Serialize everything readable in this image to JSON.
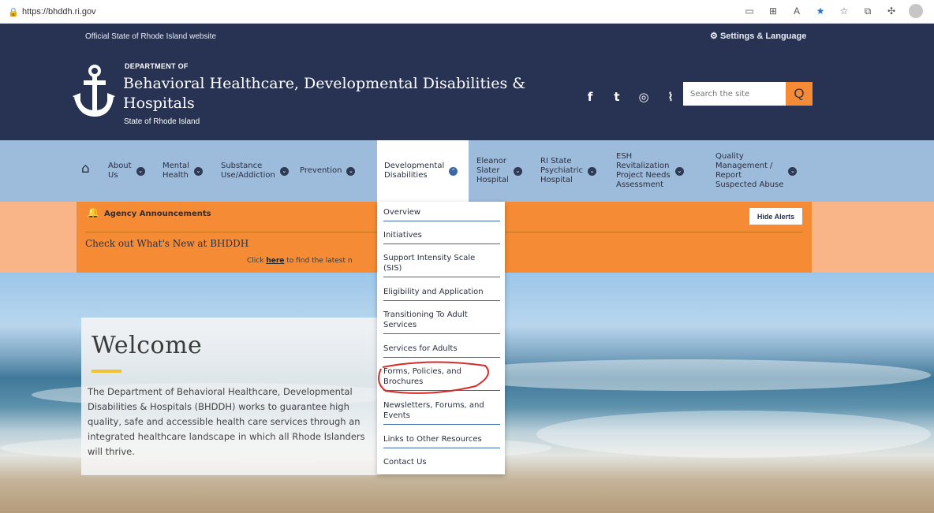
{
  "browser": {
    "url": "https://bhddh.ri.gov",
    "icons": [
      "lock-icon",
      "tab-icon",
      "grid-icon",
      "read-aloud-icon",
      "favorite-star-icon",
      "favorites-icon",
      "collections-icon",
      "extensions-icon",
      "profile-icon"
    ]
  },
  "top_strip": {
    "official": "Official State of Rhode Island website",
    "settings": "Settings & Language"
  },
  "header": {
    "dept_small": "DEPARTMENT OF",
    "dept_title": "Behavioral Healthcare, Developmental Disabilities & Hospitals",
    "dept_sub": "State of Rhode Island",
    "social": [
      "f",
      "t",
      "◎",
      "⌇"
    ],
    "search_placeholder": "Search the site",
    "search_icon": "Q"
  },
  "nav": {
    "items": [
      {
        "label": "About\nUs"
      },
      {
        "label": "Mental\nHealth"
      },
      {
        "label": "Substance\nUse/Addiction"
      },
      {
        "label": "Prevention"
      },
      {
        "label": "Developmental\nDisabilities"
      },
      {
        "label": "Eleanor\nSlater\nHospital"
      },
      {
        "label": "RI State\nPsychiatric\nHospital"
      },
      {
        "label": "ESH\nRevitalization\nProject Needs\nAssessment"
      },
      {
        "label": "Quality\nManagement /\nReport\nSuspected Abuse"
      }
    ]
  },
  "alerts": {
    "title": "Agency Announcements",
    "hide": "Hide Alerts",
    "headline": "Check out What's New at BHDDH",
    "click_prefix": "Click ",
    "click_link": "here",
    "click_suffix": " to find the latest n"
  },
  "welcome": {
    "title": "Welcome",
    "body": "The Department of Behavioral Healthcare, Developmental Disabilities & Hospitals (BHDDH) works to guarantee high quality, safe and accessible health care services through an integrated healthcare landscape in which all Rhode Islanders will thrive."
  },
  "dropdown": {
    "items": [
      {
        "label": "Overview"
      },
      {
        "label": "Initiatives"
      },
      {
        "label": "Support Intensity Scale\n(SIS)"
      },
      {
        "label": "Eligibility and Application"
      },
      {
        "label": "Transitioning To Adult\nServices"
      },
      {
        "label": "Services for Adults"
      },
      {
        "label": "Forms, Policies, and\nBrochures"
      },
      {
        "label": "Newsletters, Forums, and\nEvents"
      },
      {
        "label": "Links to Other Resources"
      },
      {
        "label": "Contact Us"
      }
    ]
  },
  "colors": {
    "navy": "#283353",
    "orange": "#f68b35",
    "nav_blue": "#9dbbdb",
    "accent": "#3d67a8",
    "annotation": "#d42b2b"
  }
}
